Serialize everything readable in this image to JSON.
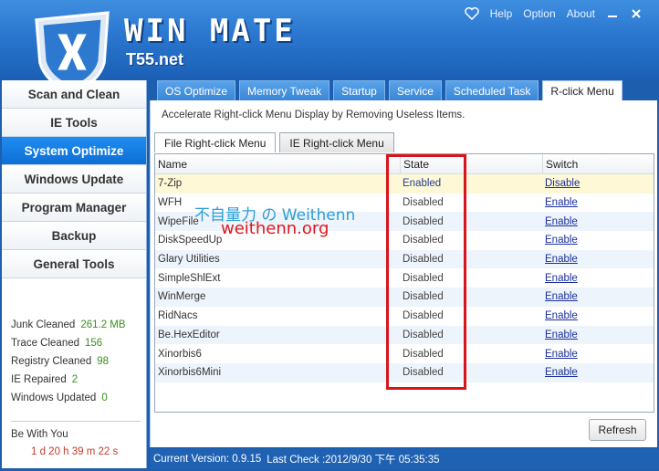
{
  "header": {
    "title": "WIN MATE",
    "subtitle": "T55.net",
    "links": {
      "help": "Help",
      "option": "Option",
      "about": "About"
    }
  },
  "sidebar": {
    "items": [
      {
        "label": "Scan and Clean",
        "active": false
      },
      {
        "label": "IE Tools",
        "active": false
      },
      {
        "label": "System Optimize",
        "active": true
      },
      {
        "label": "Windows Update",
        "active": false
      },
      {
        "label": "Program Manager",
        "active": false
      },
      {
        "label": "Backup",
        "active": false
      },
      {
        "label": "General Tools",
        "active": false
      }
    ],
    "stats": [
      {
        "label": "Junk Cleaned",
        "value": "261.2 MB"
      },
      {
        "label": "Trace Cleaned",
        "value": "156"
      },
      {
        "label": "Registry Cleaned",
        "value": "98"
      },
      {
        "label": "IE Repaired",
        "value": "2"
      },
      {
        "label": "Windows Updated",
        "value": "0"
      }
    ],
    "be_with_you": "Be With You",
    "uptime": "1 d 20 h 39 m 22 s"
  },
  "main": {
    "tabs": [
      {
        "label": "OS Optimize",
        "active": false
      },
      {
        "label": "Memory Tweak",
        "active": false
      },
      {
        "label": "Startup",
        "active": false
      },
      {
        "label": "Service",
        "active": false
      },
      {
        "label": "Scheduled Task",
        "active": false
      },
      {
        "label": "R-click Menu",
        "active": true
      }
    ],
    "description": "Accelerate Right-click Menu Display by Removing Useless Items.",
    "subtabs": [
      {
        "label": "File Right-click Menu",
        "active": true
      },
      {
        "label": "IE Right-click Menu",
        "active": false
      }
    ],
    "columns": {
      "name": "Name",
      "state": "State",
      "switch": "Switch"
    },
    "rows": [
      {
        "name": "7-Zip",
        "state": "Enabled",
        "switch": "Disable"
      },
      {
        "name": "WFH",
        "state": "Disabled",
        "switch": "Enable"
      },
      {
        "name": "WipeFile",
        "state": "Disabled",
        "switch": "Enable"
      },
      {
        "name": "DiskSpeedUp",
        "state": "Disabled",
        "switch": "Enable"
      },
      {
        "name": "Glary Utilities",
        "state": "Disabled",
        "switch": "Enable"
      },
      {
        "name": "SimpleShlExt",
        "state": "Disabled",
        "switch": "Enable"
      },
      {
        "name": "WinMerge",
        "state": "Disabled",
        "switch": "Enable"
      },
      {
        "name": "RidNacs",
        "state": "Disabled",
        "switch": "Enable"
      },
      {
        "name": "Be.HexEditor",
        "state": "Disabled",
        "switch": "Enable"
      },
      {
        "name": "Xinorbis6",
        "state": "Disabled",
        "switch": "Enable"
      },
      {
        "name": "Xinorbis6Mini",
        "state": "Disabled",
        "switch": "Enable"
      }
    ],
    "refresh_label": "Refresh"
  },
  "watermark": {
    "line1": "不自量力 の Weithenn",
    "line2": "weithenn.org"
  },
  "status": {
    "version_label": "Current Version: 0.9.15",
    "last_check": "Last Check :2012/9/30 下午 05:35:35"
  },
  "colors": {
    "header_blue": "#2a76cf",
    "active_blue": "#1f8cf0",
    "highlight_red": "#d9141a"
  }
}
